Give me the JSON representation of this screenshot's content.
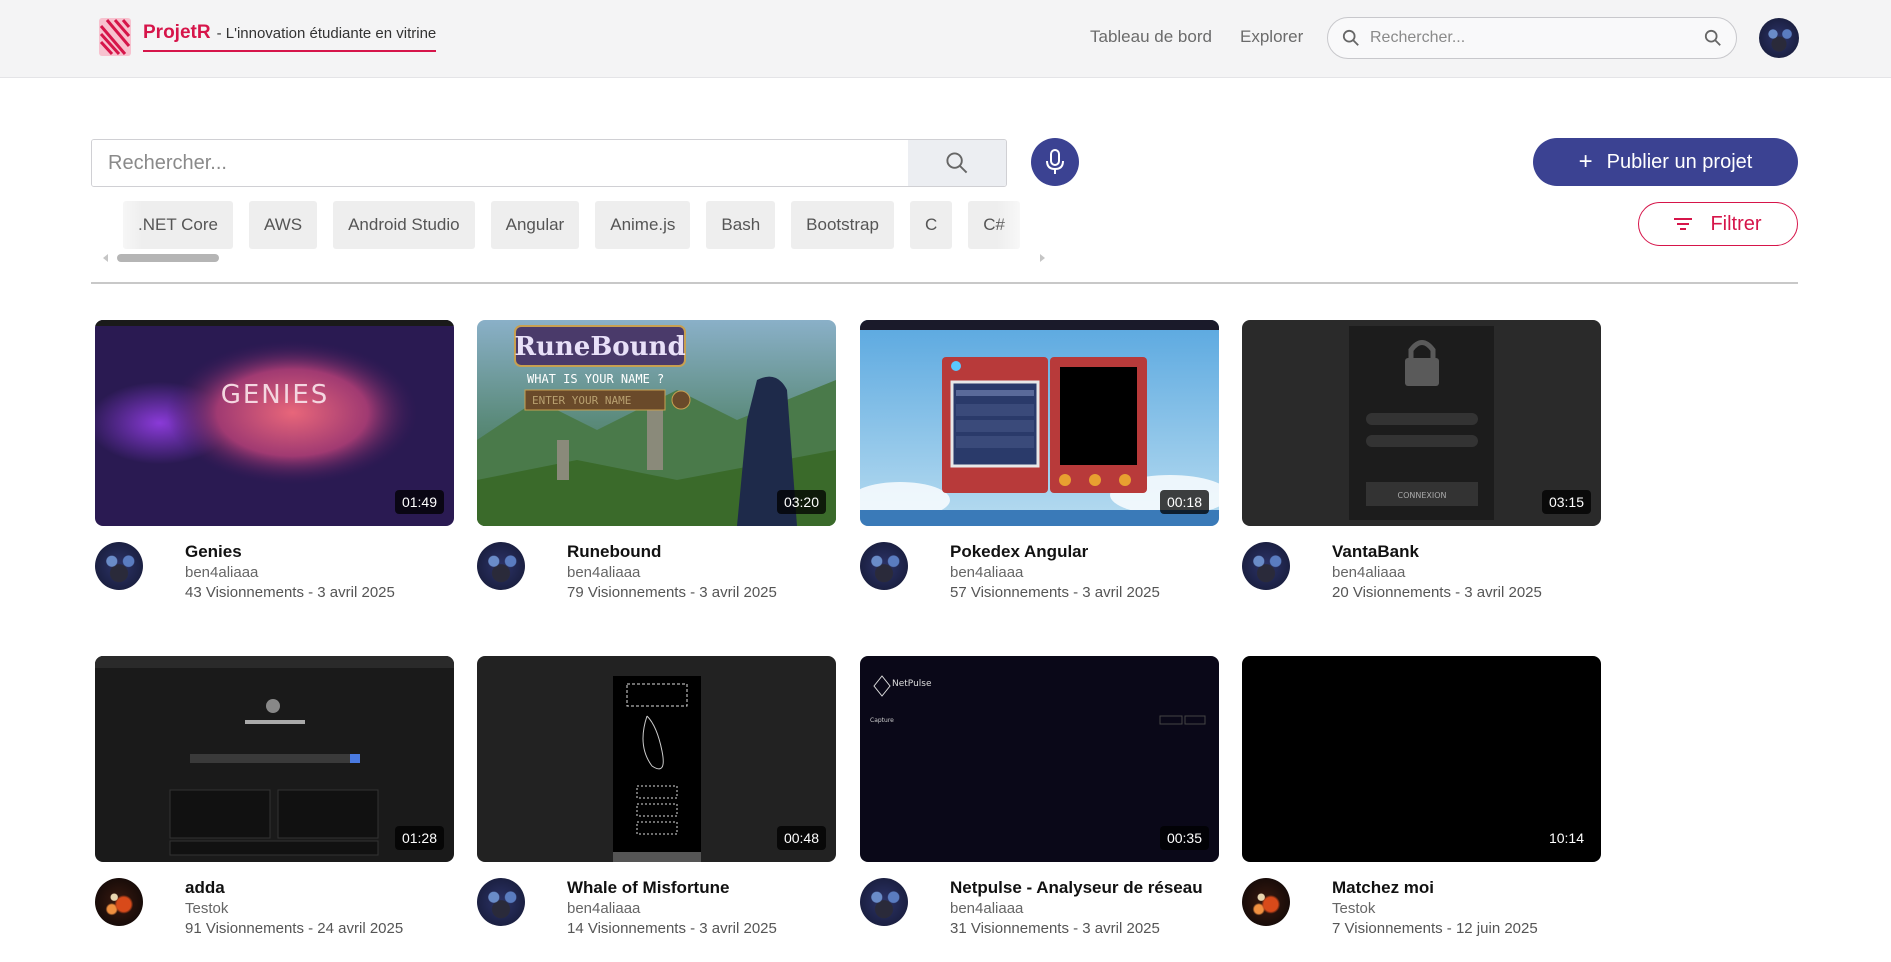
{
  "brand": {
    "name": "ProjetR",
    "tagline": "- L'innovation étudiante en vitrine"
  },
  "nav": {
    "links": [
      "Tableau de bord",
      "Explorer"
    ],
    "search_placeholder": "Rechercher..."
  },
  "main_search": {
    "placeholder": "Rechercher..."
  },
  "actions": {
    "publish_label": "Publier un projet",
    "filter_label": "Filtrer"
  },
  "tags": [
    ".NET Core",
    "AWS",
    "Android Studio",
    "Angular",
    "Anime.js",
    "Bash",
    "Bootstrap",
    "C",
    "C#"
  ],
  "videos": [
    {
      "title": "Genies",
      "author": "ben4aliaaa",
      "stats": "43 Visionnements - 3 avril 2025",
      "duration": "01:49",
      "avatar": "blue"
    },
    {
      "title": "Runebound",
      "author": "ben4aliaaa",
      "stats": "79 Visionnements - 3 avril 2025",
      "duration": "03:20",
      "avatar": "blue"
    },
    {
      "title": "Pokedex Angular",
      "author": "ben4aliaaa",
      "stats": "57 Visionnements - 3 avril 2025",
      "duration": "00:18",
      "avatar": "blue"
    },
    {
      "title": "VantaBank",
      "author": "ben4aliaaa",
      "stats": "20 Visionnements - 3 avril 2025",
      "duration": "03:15",
      "avatar": "blue"
    },
    {
      "title": "adda",
      "author": "Testok",
      "stats": "91 Visionnements - 24 avril 2025",
      "duration": "01:28",
      "avatar": "fire"
    },
    {
      "title": "Whale of Misfortune",
      "author": "ben4aliaaa",
      "stats": "14 Visionnements - 3 avril 2025",
      "duration": "00:48",
      "avatar": "blue"
    },
    {
      "title": "Netpulse - Analyseur de réseau",
      "author": "ben4aliaaa",
      "stats": "31 Visionnements - 3 avril 2025",
      "duration": "00:35",
      "avatar": "blue"
    },
    {
      "title": "Matchez moi",
      "author": "Testok",
      "stats": "7 Visionnements - 12 juin 2025",
      "duration": "10:14",
      "avatar": "fire"
    }
  ],
  "thumb_text": {
    "genies_title": "GENIES",
    "runebound_title": "RuneBound",
    "runebound_prompt": "WHAT IS YOUR NAME ?",
    "runebound_input": "ENTER YOUR NAME",
    "vantabank_button": "CONNEXION",
    "netpulse_brand": "NetPulse",
    "netpulse_capture": "Capture"
  },
  "colors": {
    "brand": "#d6154a",
    "primary": "#3b4292"
  }
}
